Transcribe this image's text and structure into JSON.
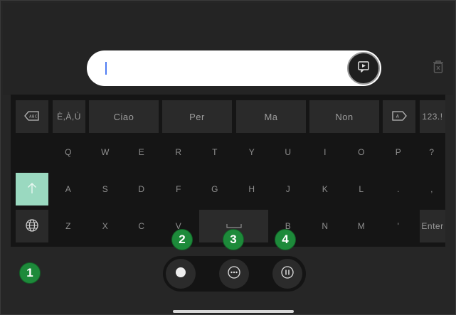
{
  "input": {
    "value": ""
  },
  "suggestions": {
    "accents": "È,À,Ù",
    "words": [
      "Ciao",
      "Per",
      "Ma",
      "Non"
    ],
    "numbers": "123.!"
  },
  "rows": {
    "row1": [
      "Q",
      "W",
      "E",
      "R",
      "T",
      "Y",
      "U",
      "I",
      "O",
      "P",
      "?"
    ],
    "row2": [
      "A",
      "S",
      "D",
      "F",
      "G",
      "H",
      "J",
      "K",
      "L",
      ".",
      ","
    ],
    "row3_left": [
      "Z",
      "X",
      "C",
      "V"
    ],
    "row3_right": [
      "B",
      "N",
      "M",
      "'"
    ],
    "enter": "Enter"
  },
  "icons": {
    "delete_left": "backspace-icon",
    "delete_right": "forward-delete-icon",
    "globe": "globe-icon",
    "shift": "shift-arrow-icon",
    "send": "send-icon",
    "trash": "trash-icon"
  },
  "badges": [
    "1",
    "2",
    "3",
    "4"
  ],
  "colors": {
    "badge": "#1d8a3a",
    "shift": "#9ad9c0",
    "caret": "#4f7cf2"
  }
}
